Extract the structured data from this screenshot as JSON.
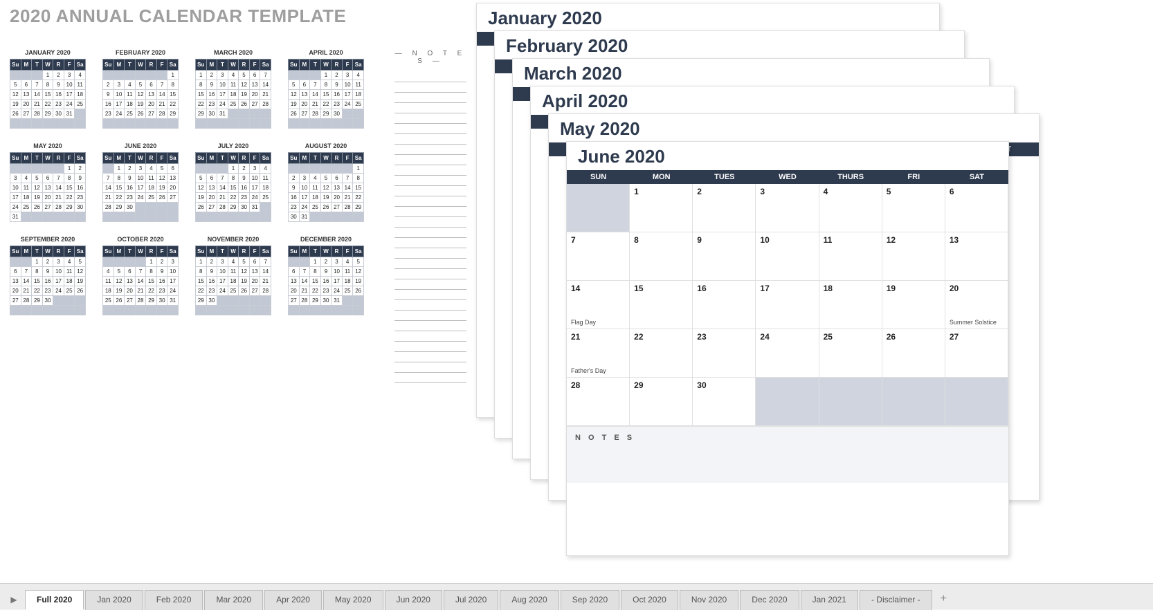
{
  "annual": {
    "title": "2020 ANNUAL CALENDAR TEMPLATE",
    "notes_label": "— N O T E S —",
    "day_head": [
      "Su",
      "M",
      "T",
      "W",
      "R",
      "F",
      "Sa"
    ],
    "months": [
      {
        "name": "JANUARY 2020",
        "start": 3,
        "days": 31
      },
      {
        "name": "FEBRUARY 2020",
        "start": 6,
        "days": 29
      },
      {
        "name": "MARCH 2020",
        "start": 0,
        "days": 31
      },
      {
        "name": "APRIL 2020",
        "start": 3,
        "days": 30
      },
      {
        "name": "MAY 2020",
        "start": 5,
        "days": 31
      },
      {
        "name": "JUNE 2020",
        "start": 1,
        "days": 30
      },
      {
        "name": "JULY 2020",
        "start": 3,
        "days": 31
      },
      {
        "name": "AUGUST 2020",
        "start": 6,
        "days": 31
      },
      {
        "name": "SEPTEMBER 2020",
        "start": 2,
        "days": 30
      },
      {
        "name": "OCTOBER 2020",
        "start": 4,
        "days": 31
      },
      {
        "name": "NOVEMBER 2020",
        "start": 0,
        "days": 30
      },
      {
        "name": "DECEMBER 2020",
        "start": 2,
        "days": 31
      }
    ]
  },
  "stack": {
    "day_head": [
      "SUN",
      "MON",
      "TUES",
      "WED",
      "THURS",
      "FRI",
      "SAT"
    ],
    "sheets": [
      {
        "title": "January 2020"
      },
      {
        "title": "February 2020"
      },
      {
        "title": "March 2020"
      },
      {
        "title": "April 2020"
      },
      {
        "title": "May 2020"
      }
    ],
    "front": {
      "title": "June 2020",
      "start": 1,
      "days": 30,
      "events": {
        "14": "Flag Day",
        "20": "Summer Solstice",
        "21": "Father's Day"
      },
      "notes_label": "N O T E S"
    }
  },
  "tabs": {
    "items": [
      "Full 2020",
      "Jan 2020",
      "Feb 2020",
      "Mar 2020",
      "Apr 2020",
      "May 2020",
      "Jun 2020",
      "Jul 2020",
      "Aug 2020",
      "Sep 2020",
      "Oct 2020",
      "Nov 2020",
      "Dec 2020",
      "Jan 2021",
      "- Disclaimer -"
    ],
    "active": 0,
    "add": "+"
  }
}
